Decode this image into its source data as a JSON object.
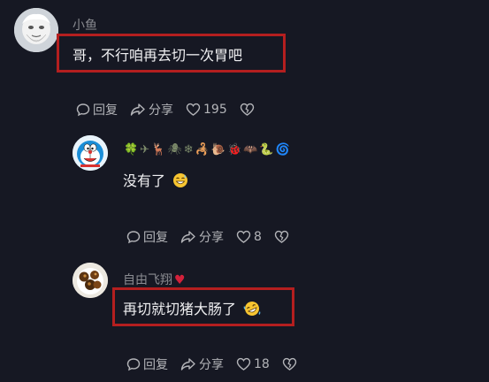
{
  "comments": [
    {
      "username": "小鱼",
      "text": "哥，不行咱再去切一次胃吧",
      "reply_label": "回复",
      "share_label": "分享",
      "like_count": "195",
      "avatar_icon": "old-man-avatar-icon"
    },
    {
      "username": "",
      "badges": "🍀✈🦌🕷❄🦂🐌🐞🦇🐍🌀",
      "text": "没有了",
      "text_emoji": "grinning-sweat-emoji",
      "reply_label": "回复",
      "share_label": "分享",
      "like_count": "8",
      "avatar_icon": "doraemon-avatar-icon"
    },
    {
      "username": "自由飞翔",
      "name_badge": "heart-icon",
      "text": "再切就切猪大肠了",
      "text_emoji": "rofl-emoji",
      "reply_label": "回复",
      "share_label": "分享",
      "like_count": "18",
      "avatar_icon": "food-avatar-icon"
    }
  ],
  "colors": {
    "background": "#161823",
    "highlight_border": "#b41f1f",
    "secondary_text": "#8a8b91",
    "heart": "#d3213b"
  }
}
